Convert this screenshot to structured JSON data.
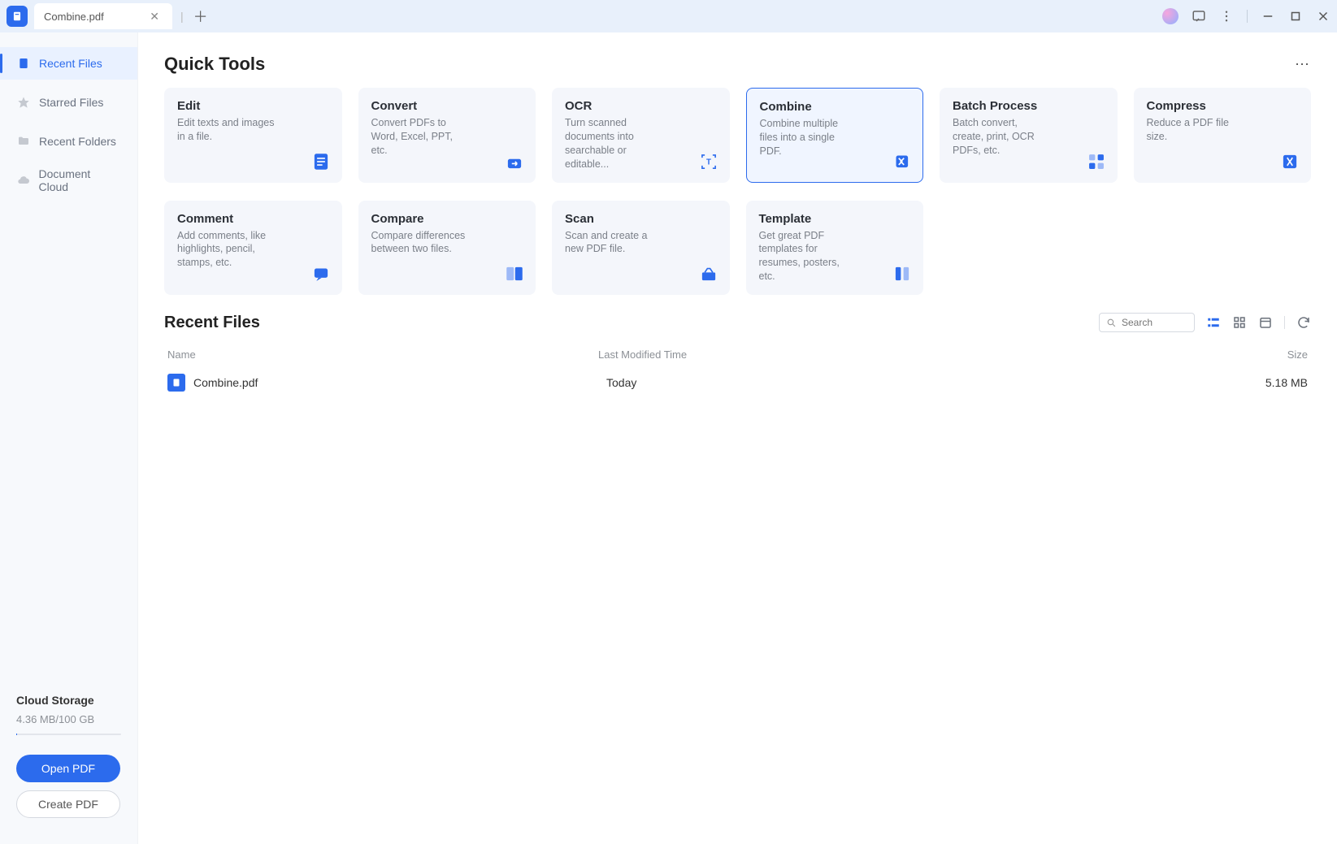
{
  "titlebar": {
    "tab_title": "Combine.pdf"
  },
  "sidebar": {
    "items": [
      {
        "label": "Recent Files"
      },
      {
        "label": "Starred Files"
      },
      {
        "label": "Recent Folders"
      },
      {
        "label": "Document Cloud"
      }
    ],
    "storage_title": "Cloud Storage",
    "storage_used": "4.36 MB/100 GB",
    "open_pdf_label": "Open PDF",
    "create_pdf_label": "Create PDF"
  },
  "quick_tools": {
    "heading": "Quick Tools",
    "cards": [
      {
        "title": "Edit",
        "desc": "Edit texts and images in a file."
      },
      {
        "title": "Convert",
        "desc": "Convert PDFs to Word, Excel, PPT, etc."
      },
      {
        "title": "OCR",
        "desc": "Turn scanned documents into searchable or editable..."
      },
      {
        "title": "Combine",
        "desc": "Combine multiple files into a single PDF."
      },
      {
        "title": "Batch Process",
        "desc": "Batch convert, create, print, OCR PDFs, etc."
      },
      {
        "title": "Compress",
        "desc": "Reduce a PDF file size."
      },
      {
        "title": "Comment",
        "desc": "Add comments, like highlights, pencil, stamps, etc."
      },
      {
        "title": "Compare",
        "desc": "Compare differences between two files."
      },
      {
        "title": "Scan",
        "desc": "Scan and create a new PDF file."
      },
      {
        "title": "Template",
        "desc": "Get great PDF templates for resumes, posters, etc."
      }
    ]
  },
  "recent": {
    "heading": "Recent Files",
    "search_placeholder": "Search",
    "columns": {
      "name": "Name",
      "modified": "Last Modified Time",
      "size": "Size"
    },
    "rows": [
      {
        "name": "Combine.pdf",
        "modified": "Today",
        "size": "5.18 MB"
      }
    ]
  }
}
